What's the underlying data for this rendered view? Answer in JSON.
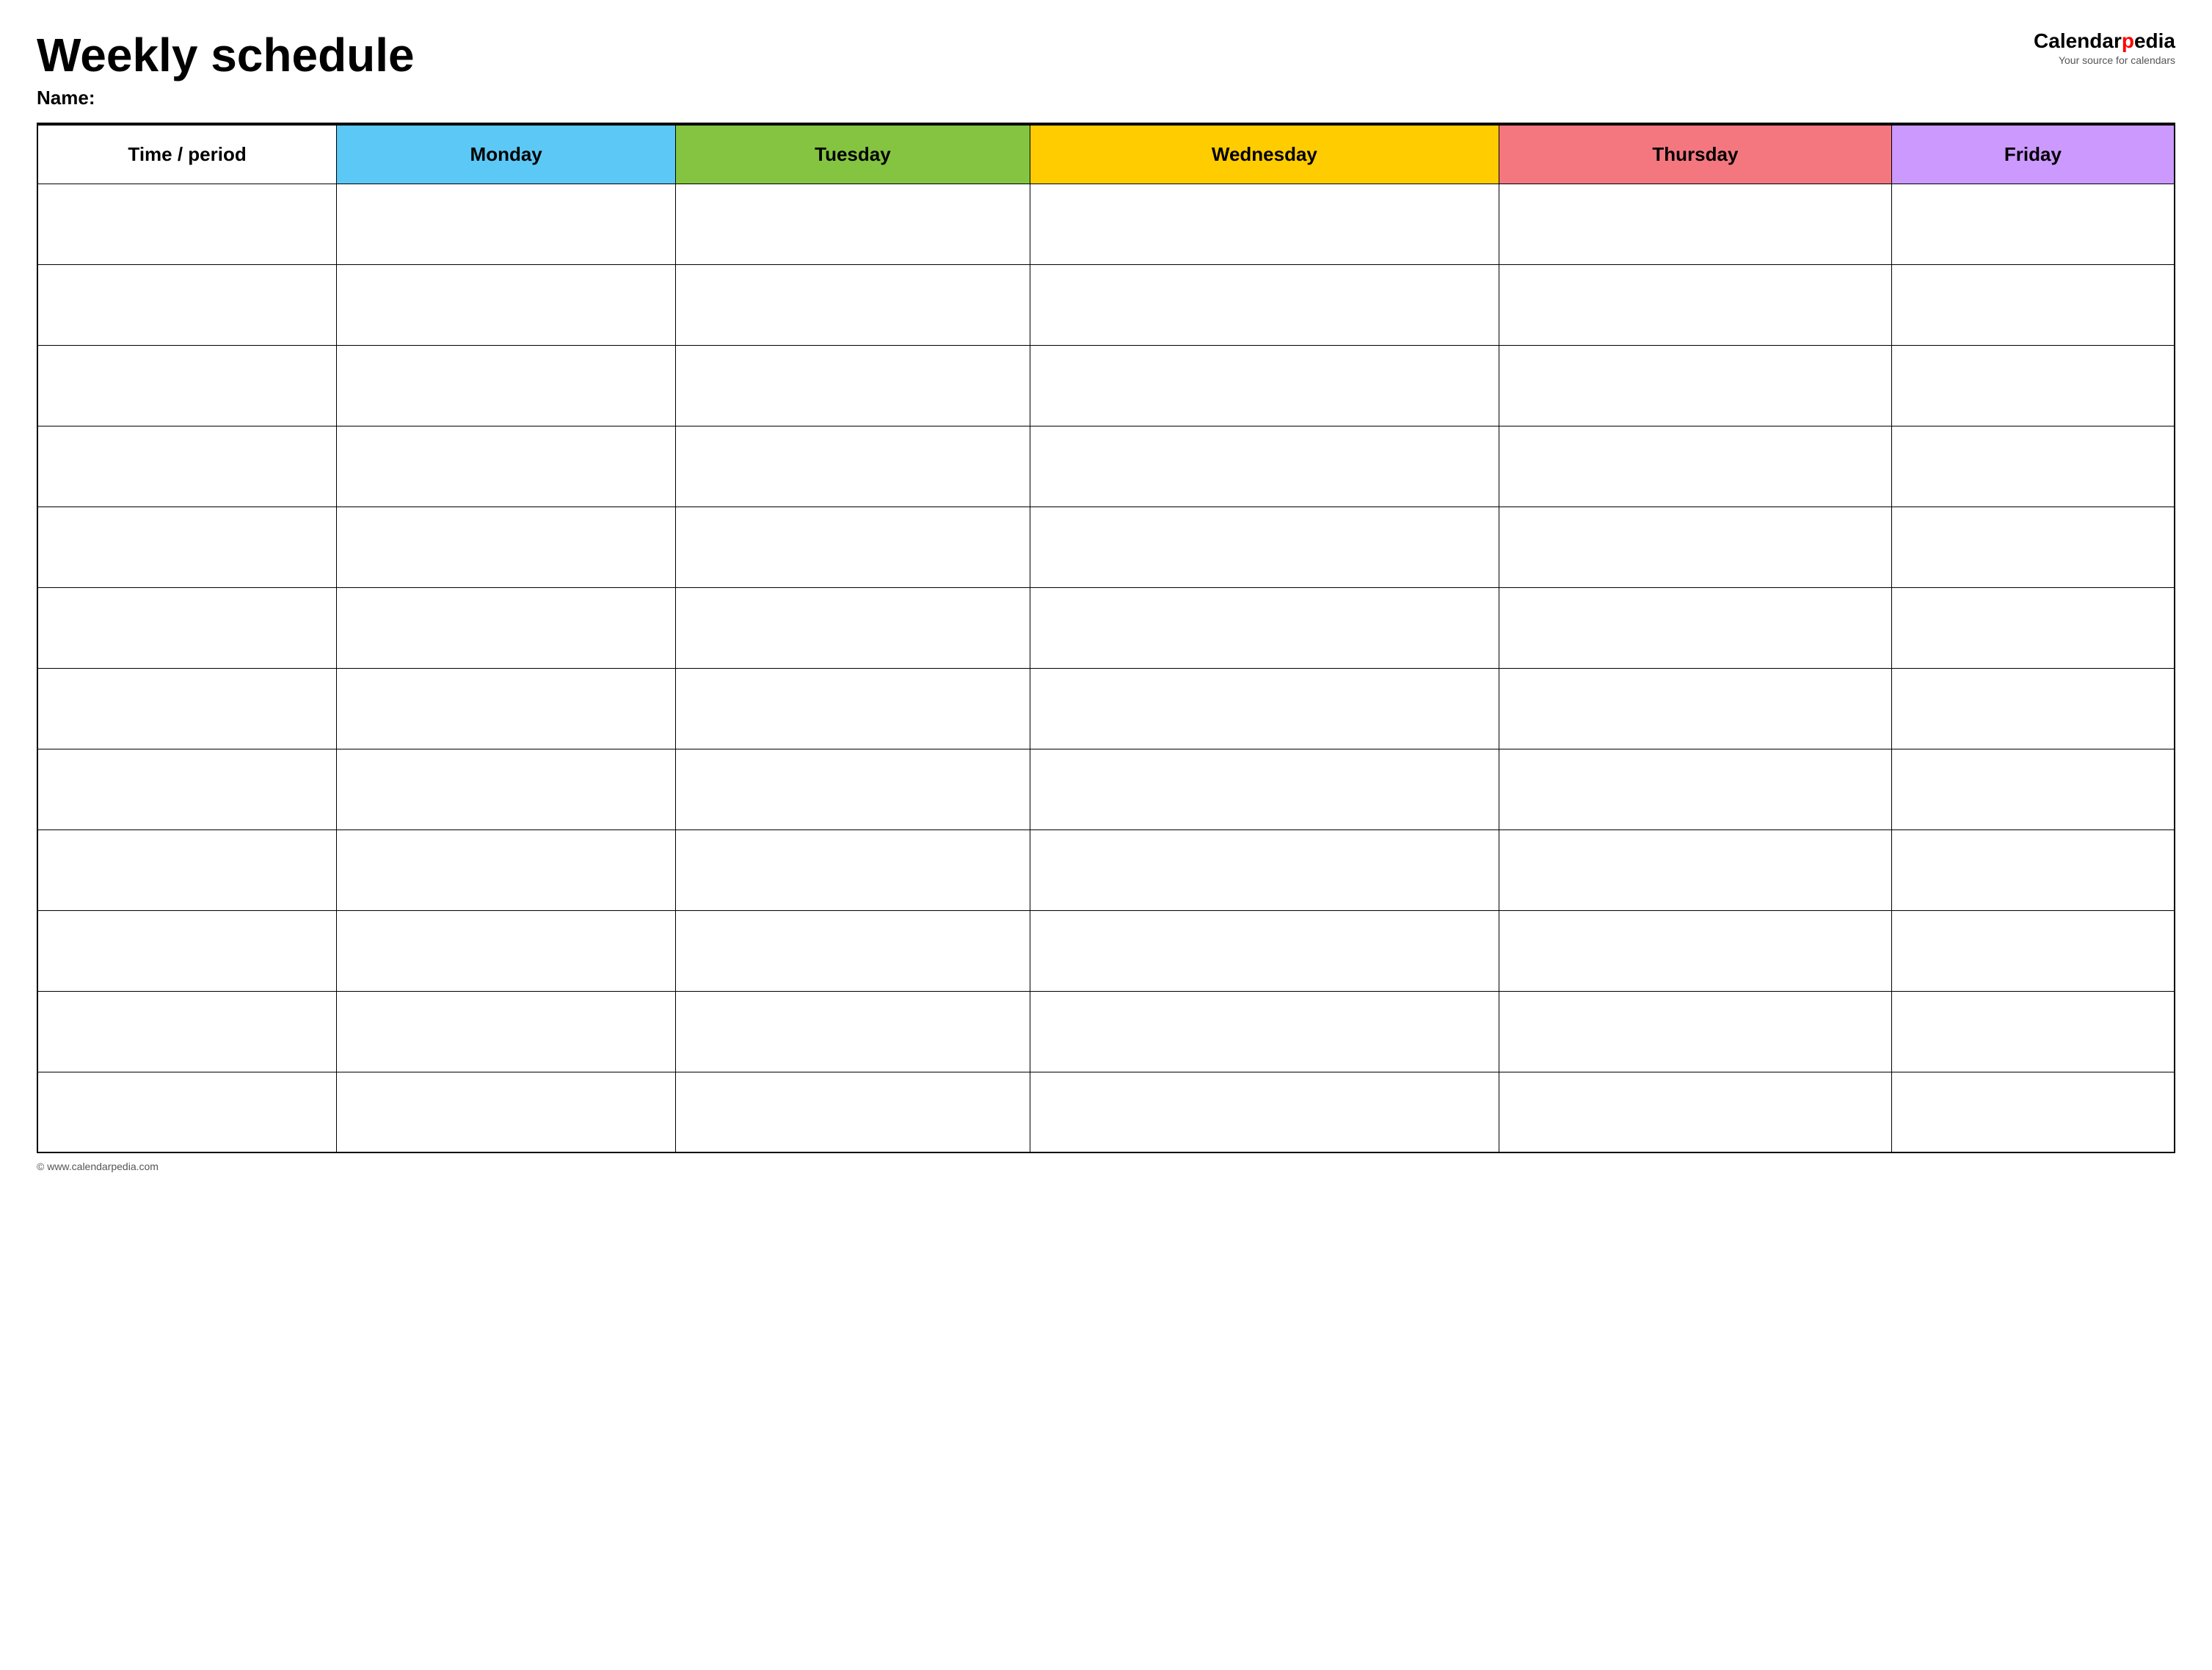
{
  "header": {
    "main_title": "Weekly schedule",
    "name_label": "Name:",
    "logo": {
      "brand_part1": "Calendar",
      "brand_part2_red": "p",
      "brand_part3": "edia",
      "tagline": "Your source for calendars"
    }
  },
  "table": {
    "columns": [
      {
        "id": "time",
        "label": "Time / period",
        "color": "col-time"
      },
      {
        "id": "monday",
        "label": "Monday",
        "color": "col-monday"
      },
      {
        "id": "tuesday",
        "label": "Tuesday",
        "color": "col-tuesday"
      },
      {
        "id": "wednesday",
        "label": "Wednesday",
        "color": "col-wednesday"
      },
      {
        "id": "thursday",
        "label": "Thursday",
        "color": "col-thursday"
      },
      {
        "id": "friday",
        "label": "Friday",
        "color": "col-friday"
      }
    ],
    "row_count": 12
  },
  "footer": {
    "url": "© www.calendarpedia.com"
  }
}
